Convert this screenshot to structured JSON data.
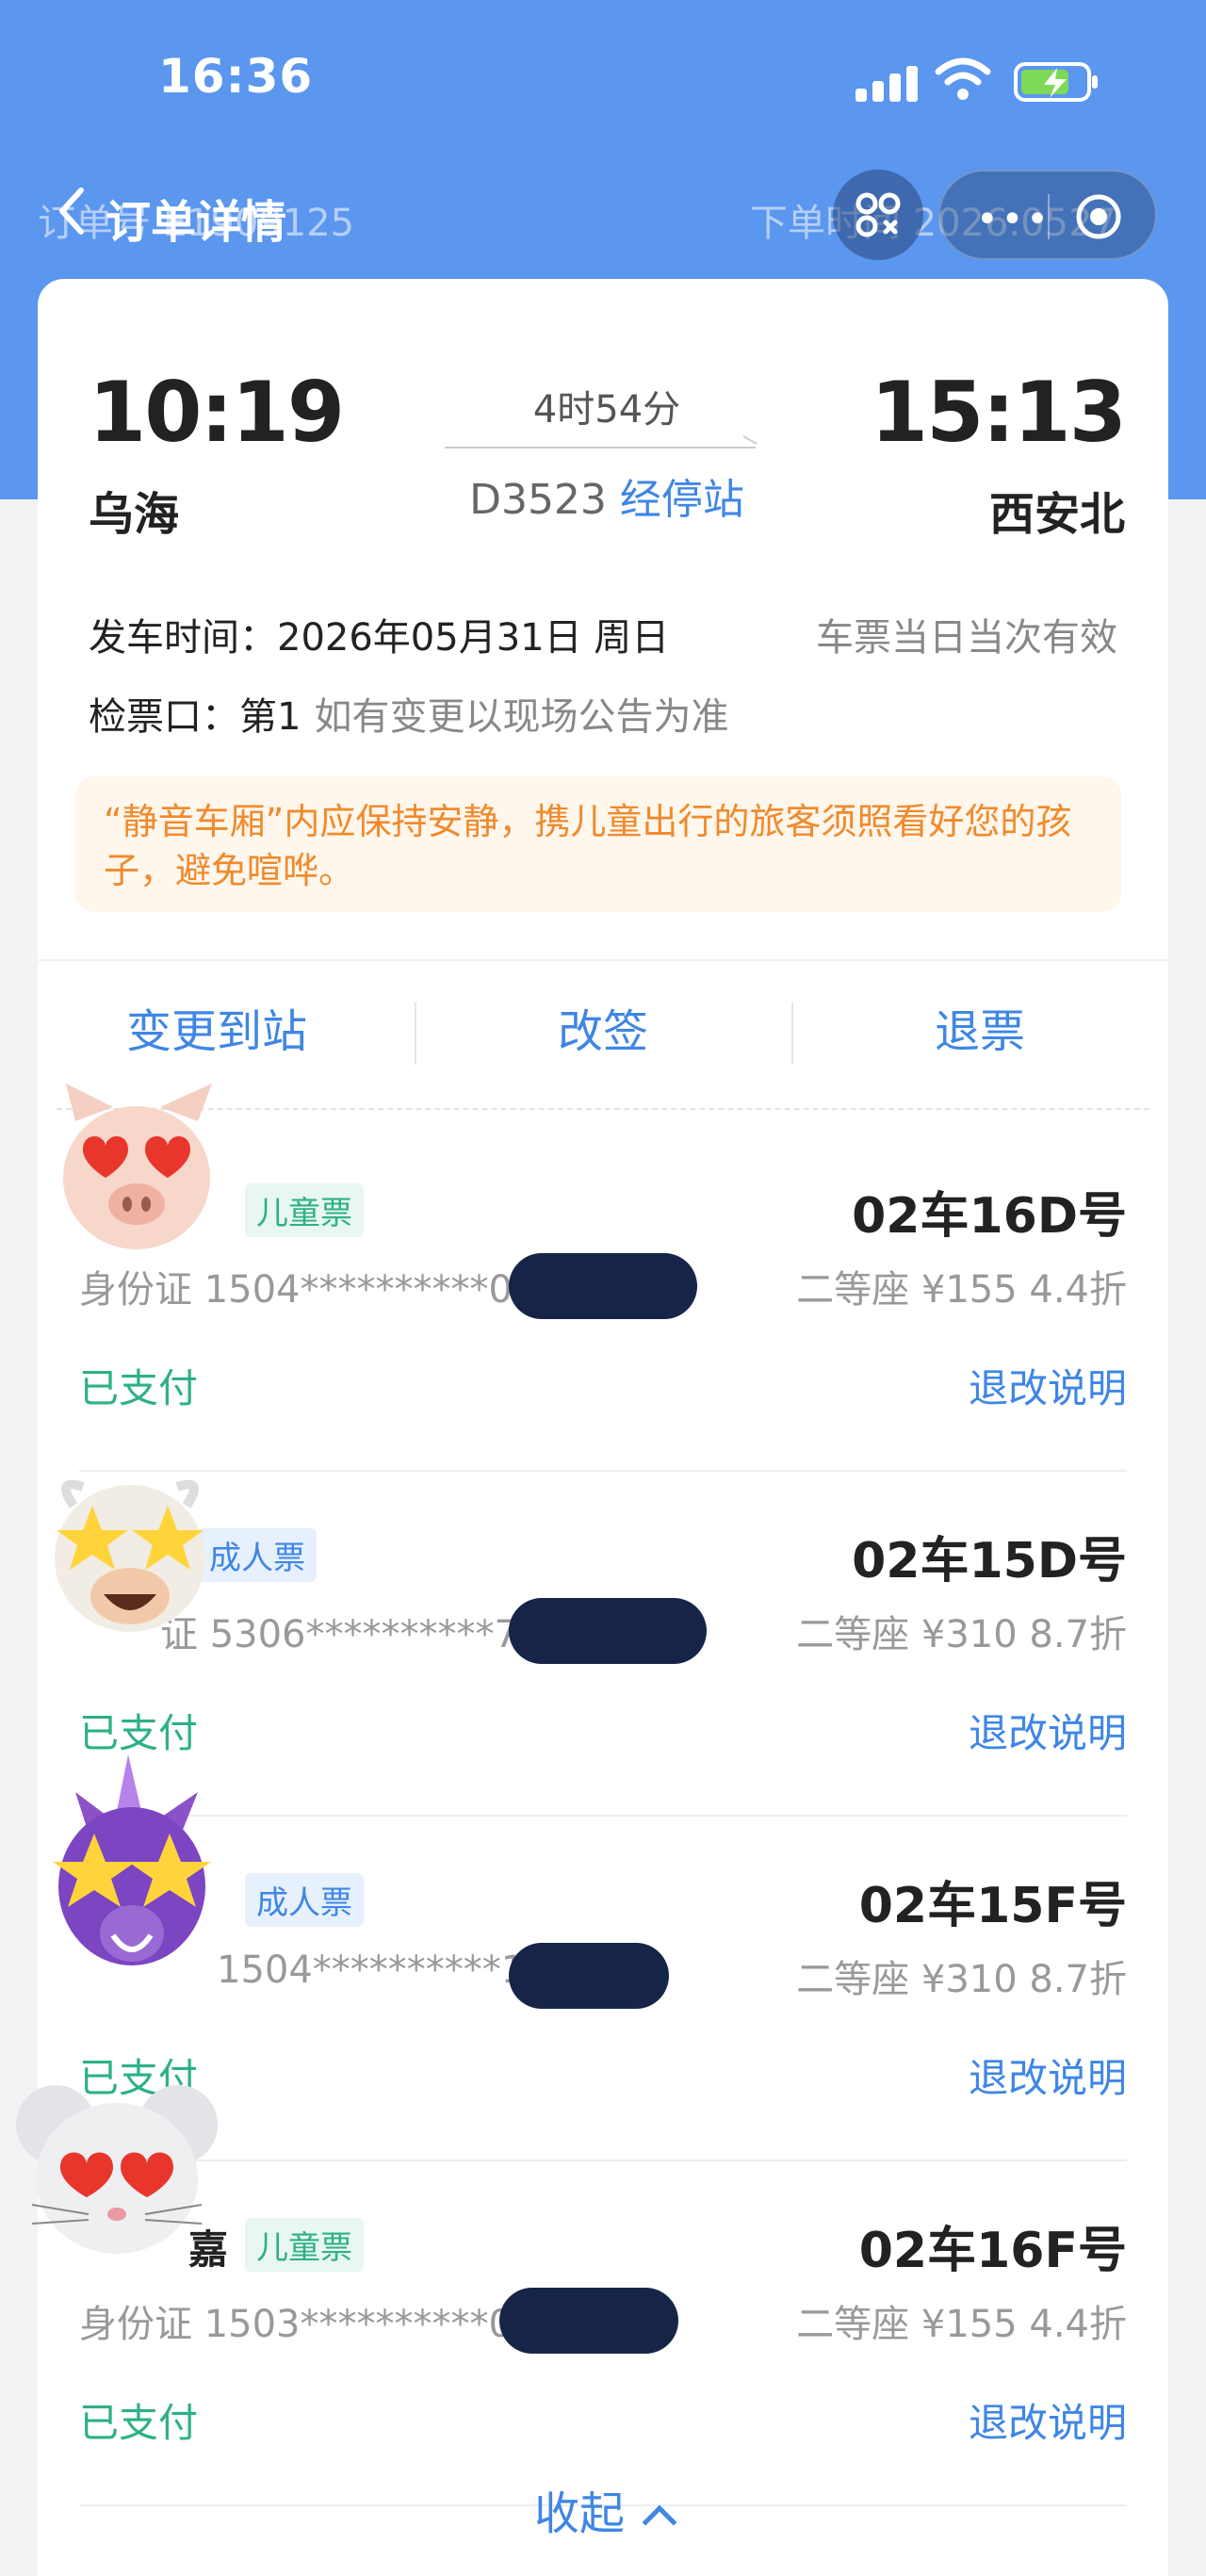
{
  "status_bar": {
    "time": "16:36"
  },
  "nav": {
    "title": "订单详情",
    "order_no_ghost": "订单号 E1909125",
    "order_time_ghost": "下单时间 2026.0527",
    "capsule_dots": "•••"
  },
  "trip": {
    "departure_time": "10:19",
    "arrival_time": "15:13",
    "departure_station": "乌海",
    "arrival_station": "西安北",
    "duration": "4时54分",
    "train_number": "D3523",
    "stops_link": "经停站",
    "depart_date": "发车时间：2026年05月31日 周日",
    "validity": "车票当日当次有效",
    "gate_label": "检票口：第1",
    "gate_note": "如有变更以现场公告为准",
    "notice": "“静音车厢”内应保持安静，携儿童出行的旅客须照看好您的孩子，避免喧哗。"
  },
  "actions": {
    "change_station": "变更到站",
    "reschedule": "改签",
    "refund": "退票"
  },
  "passengers": [
    {
      "name": "",
      "ticket_type": "儿童票",
      "seat": "02车16D号",
      "id": "身份证 1504**********019",
      "seat_price": "二等座 ¥155 4.4折",
      "status": "已支付",
      "rules": "退改说明"
    },
    {
      "name": "",
      "ticket_type": "成人票",
      "seat": "02车15D号",
      "id": "证 5306**********780",
      "seat_price": "二等座 ¥310 8.7折",
      "status": "已支付",
      "rules": "退改说明"
    },
    {
      "name": "",
      "ticket_type": "成人票",
      "seat": "02车15F号",
      "id": "1504**********157",
      "seat_price": "二等座 ¥310 8.7折",
      "status": "已支付",
      "rules": "退改说明"
    },
    {
      "name": "嘉",
      "ticket_type": "儿童票",
      "seat": "02车16F号",
      "id": "身份证 1503**********019",
      "seat_price": "二等座 ¥155 4.4折",
      "status": "已支付",
      "rules": "退改说明"
    }
  ],
  "collapse_label": "收起",
  "colors": {
    "primary": "#5b96ef",
    "link": "#3f86e5",
    "paid": "#2eb089",
    "notice": "#f08a2c"
  },
  "icons": [
    "signal-icon",
    "wifi-icon",
    "battery-charging-icon",
    "back-icon",
    "scan-icon",
    "more-icon",
    "target-icon",
    "chevron-up-icon"
  ]
}
